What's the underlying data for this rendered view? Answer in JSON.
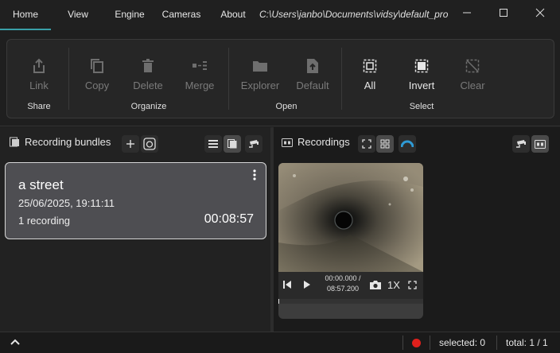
{
  "menu": {
    "tabs": [
      {
        "label": "Home",
        "active": true
      },
      {
        "label": "View"
      },
      {
        "label": "Engine"
      },
      {
        "label": "Cameras"
      },
      {
        "label": "About"
      }
    ],
    "path": "C:\\Users\\janbo\\Documents\\vidsy\\default_pro"
  },
  "ribbon": {
    "share": {
      "label": "Share",
      "buttons": [
        {
          "label": "Link",
          "icon": "share-icon"
        }
      ]
    },
    "organize": {
      "label": "Organize",
      "buttons": [
        {
          "label": "Copy",
          "icon": "copy-icon"
        },
        {
          "label": "Delete",
          "icon": "trash-icon"
        },
        {
          "label": "Merge",
          "icon": "merge-icon"
        }
      ]
    },
    "open": {
      "label": "Open",
      "buttons": [
        {
          "label": "Explorer",
          "icon": "folder-icon"
        },
        {
          "label": "Default",
          "icon": "file-open-icon"
        }
      ]
    },
    "select": {
      "label": "Select",
      "buttons": [
        {
          "label": "All",
          "icon": "select-all-icon"
        },
        {
          "label": "Invert",
          "icon": "select-invert-icon"
        },
        {
          "label": "Clear",
          "icon": "select-clear-icon"
        }
      ]
    }
  },
  "bundles": {
    "title": "Recording bundles",
    "items": [
      {
        "title": "a street",
        "date": "25/06/2025, 19:11:11",
        "count": "1 recording",
        "duration": "00:08:57"
      }
    ]
  },
  "recordings": {
    "title": "Recordings",
    "items": [
      {
        "time_current": "00:00.000 /",
        "time_total": "08:57.200",
        "speed": "1X",
        "progress": 0
      }
    ]
  },
  "status": {
    "selected": "selected: 0",
    "total": "total: 1 / 1",
    "record_color": "#e0201c"
  },
  "colors": {
    "accent": "#3aa0a8",
    "blue_icon": "#2f9bd6"
  }
}
